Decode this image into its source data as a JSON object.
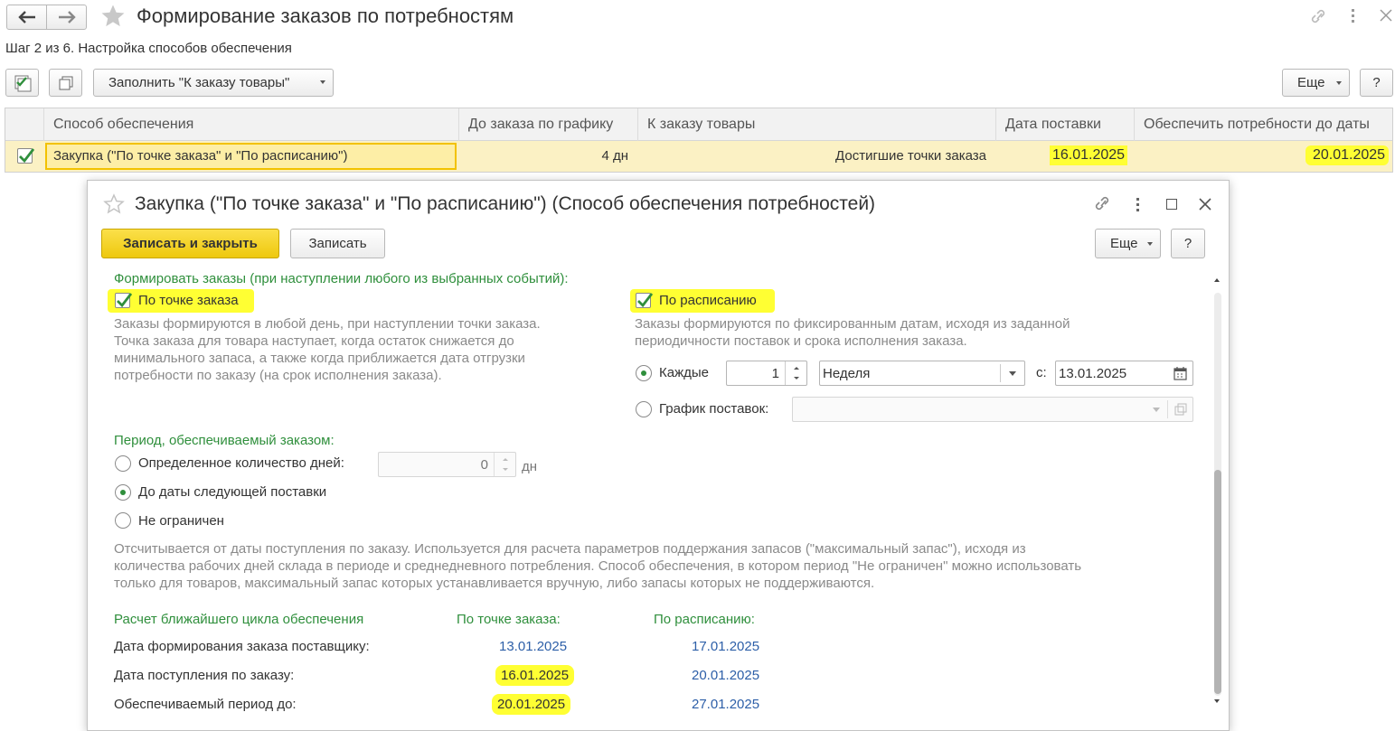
{
  "main": {
    "title": "Формирование заказов по потребностям",
    "step": "Шаг 2 из 6. Настройка способов обеспечения",
    "fill_button": "Заполнить \"К заказу товары\"",
    "more_button": "Еще",
    "help_button": "?",
    "table": {
      "columns": [
        "Способ обеспечения",
        "До заказа по графику",
        "К заказу товары",
        "Дата поставки",
        "Обеспечить потребности до даты"
      ],
      "row": {
        "method": "Закупка (\"По точке заказа\" и \"По расписанию\")",
        "until_order": "4 дн",
        "to_order": "Достигшие точки заказа",
        "delivery_date": "16.01.2025",
        "provide_until": "20.01.2025"
      }
    }
  },
  "dialog": {
    "title": "Закупка (\"По точке заказа\" и \"По расписанию\") (Способ обеспечения потребностей)",
    "save_close": "Записать и закрыть",
    "save": "Записать",
    "more": "Еще",
    "help": "?",
    "form_orders_header": "Формировать заказы (при наступлении любого из выбранных событий):",
    "by_order_point": "По точке заказа",
    "by_order_point_desc": [
      "Заказы формируются в любой день, при наступлении точки заказа.",
      "Точка заказа для товара  наступает, когда остаток снижается до",
      "минимального запаса, а также когда приближается дата отгрузки",
      "потребности по заказу (на срок исполнения заказа)."
    ],
    "by_schedule": "По расписанию",
    "by_schedule_desc": [
      "Заказы формируются по фиксированным датам, исходя из заданной",
      "периодичности поставок и срока исполнения заказа."
    ],
    "every_label": "Каждые",
    "every_value": "1",
    "period_value": "Неделя",
    "from_label": "с:",
    "from_date": "13.01.2025",
    "schedule_label": "График поставок:",
    "period_header": "Период, обеспечиваемый заказом:",
    "opt_days": "Определенное количество дней:",
    "days_value": "0",
    "days_unit": "дн",
    "opt_next": "До даты следующей поставки",
    "opt_unlimited": "Не ограничен",
    "period_desc": [
      "Отсчитывается от даты поступления по заказу. Используется для расчета параметров поддержания запасов (\"максимальный запас\"), исходя из",
      "количества рабочих дней склада в периоде и среднедневного потребления. Способ обеспечения, в котором период \"Не ограничен\" можно использовать",
      "только для товаров, максимальный запас которых устанавливается вручную, либо запасы которых не поддерживаются."
    ],
    "calc": {
      "header": "Расчет ближайшего цикла обеспечения",
      "col_point": "По точке заказа:",
      "col_schedule": "По расписанию:",
      "rows": [
        {
          "label": "Дата формирования заказа поставщику:",
          "point": "13.01.2025",
          "schedule": "17.01.2025"
        },
        {
          "label": "Дата поступления по заказу:",
          "point": "16.01.2025",
          "schedule": "20.01.2025"
        },
        {
          "label": "Обеспечиваемый период до:",
          "point": "20.01.2025",
          "schedule": "27.01.2025"
        }
      ]
    }
  },
  "colors": {
    "accent_green": "#2f8f3c",
    "highlight": "#ffff33",
    "primary_button": "#f5d31a",
    "link_blue": "#2d5fa8"
  }
}
